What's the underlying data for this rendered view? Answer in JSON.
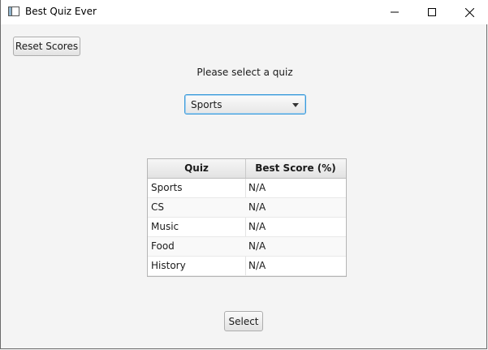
{
  "window": {
    "title": "Best Quiz Ever",
    "app_icon": "window-app-icon",
    "controls": {
      "minimize_icon": "minimize-icon",
      "maximize_icon": "maximize-icon",
      "close_icon": "close-icon"
    }
  },
  "toolbar": {
    "reset_label": "Reset Scores"
  },
  "main": {
    "prompt": "Please select a quiz",
    "quiz_select": {
      "selected": "Sports",
      "icon": "chevron-down-icon"
    },
    "scores_table": {
      "headers": [
        "Quiz",
        "Best Score (%)"
      ],
      "rows": [
        {
          "quiz": "Sports",
          "score": "N/A"
        },
        {
          "quiz": "CS",
          "score": "N/A"
        },
        {
          "quiz": "Music",
          "score": "N/A"
        },
        {
          "quiz": "Food",
          "score": "N/A"
        },
        {
          "quiz": "History",
          "score": "N/A"
        }
      ]
    },
    "select_label": "Select"
  },
  "colors": {
    "focus_border": "#3a9ad9",
    "background": "#f4f4f4"
  }
}
